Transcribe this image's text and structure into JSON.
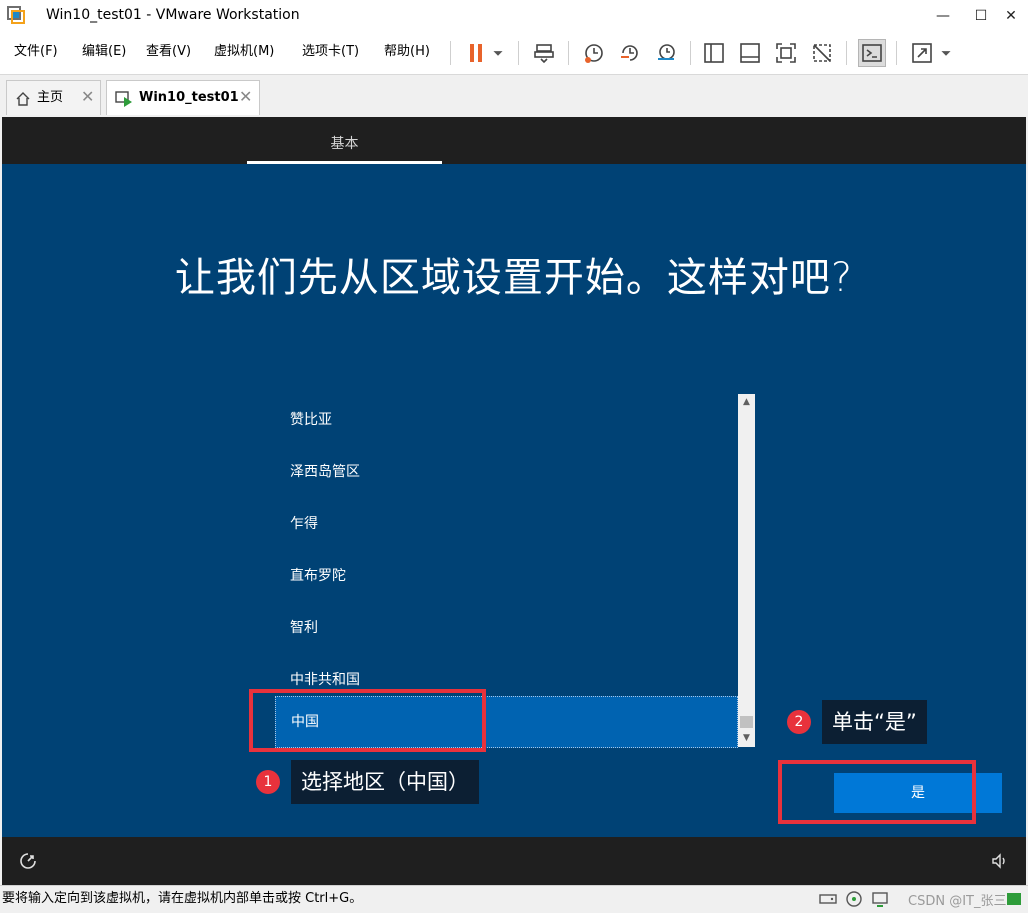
{
  "window": {
    "title": "Win10_test01 - VMware Workstation",
    "minimize_glyph": "—",
    "maximize_glyph": "☐",
    "close_glyph": "✕"
  },
  "menu": {
    "items": [
      "文件(F)",
      "编辑(E)",
      "查看(V)",
      "虚拟机(M)",
      "选项卡(T)",
      "帮助(H)"
    ]
  },
  "toolbar": {
    "icons": [
      "pause-icon",
      "dropdown-icon",
      "send-keys-icon",
      "snapshot-icon",
      "revert-snapshot-icon",
      "snapshot-manager-icon",
      "library-view-icon",
      "thumbnail-view-icon",
      "full-screen-icon",
      "unity-icon",
      "console-view-icon",
      "stretch-icon"
    ],
    "accent_color": "#e8632b"
  },
  "tabs": [
    {
      "label": "主页",
      "icon": "home-icon",
      "active": false
    },
    {
      "label": "Win10_test01",
      "icon": "vm-running-icon",
      "active": true
    }
  ],
  "oobe": {
    "step_label": "基本",
    "title": "让我们先从区域设置开始。这样对吧?",
    "regions": [
      "赞比亚",
      "泽西岛管区",
      "乍得",
      "直布罗陀",
      "智利",
      "中非共和国",
      "中国"
    ],
    "selected_region": "中国",
    "yes_button": "是",
    "colors": {
      "background": "#004275",
      "selected": "#0063b1",
      "button": "#0078d7"
    }
  },
  "annotations": [
    {
      "number": "1",
      "text": "选择地区（中国）"
    },
    {
      "number": "2",
      "text": "单击“是”"
    }
  ],
  "statusbar": {
    "message": "要将输入定向到该虚拟机，请在虚拟机内部单击或按 Ctrl+G。",
    "watermark": "CSDN @IT_张三"
  }
}
